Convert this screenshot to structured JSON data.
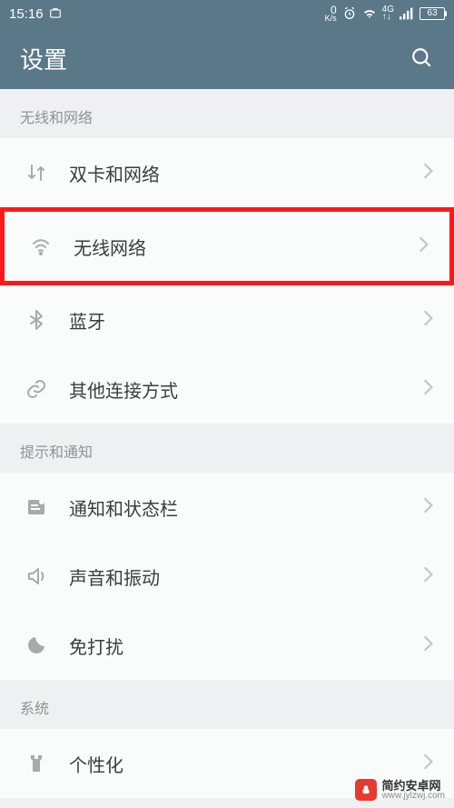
{
  "status_bar": {
    "time": "15:16",
    "data_rate": "0",
    "data_unit": "K/s",
    "network_badge": "4G",
    "battery": "63"
  },
  "header": {
    "title": "设置"
  },
  "sections": [
    {
      "title": "无线和网络",
      "items": [
        {
          "icon": "swap",
          "label": "双卡和网络",
          "highlighted": false
        },
        {
          "icon": "wifi",
          "label": "无线网络",
          "highlighted": true
        },
        {
          "icon": "bluetooth",
          "label": "蓝牙",
          "highlighted": false
        },
        {
          "icon": "link",
          "label": "其他连接方式",
          "highlighted": false
        }
      ]
    },
    {
      "title": "提示和通知",
      "items": [
        {
          "icon": "badge",
          "label": "通知和状态栏",
          "highlighted": false
        },
        {
          "icon": "sound",
          "label": "声音和振动",
          "highlighted": false
        },
        {
          "icon": "dnd",
          "label": "免打扰",
          "highlighted": false
        }
      ]
    },
    {
      "title": "系统",
      "items": [
        {
          "icon": "theme",
          "label": "个性化",
          "highlighted": false
        }
      ]
    }
  ],
  "watermark": {
    "line1": "简约安卓网",
    "line2": "www.jylzwj.com"
  }
}
